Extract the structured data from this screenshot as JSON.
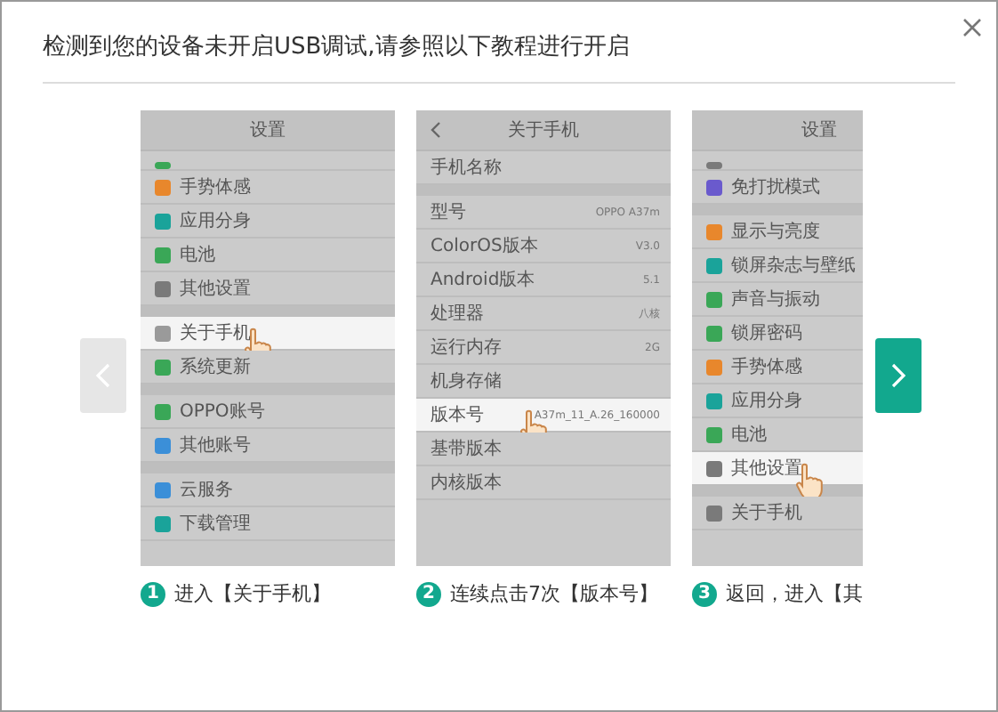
{
  "dialog": {
    "title": "检测到您的设备未开启USB调试,请参照以下教程进行开启"
  },
  "steps": [
    {
      "number": "1",
      "caption": "进入【关于手机】",
      "screen": {
        "title": "设置",
        "back": false,
        "rows": [
          {
            "kind": "partial",
            "color": "#3aa757"
          },
          {
            "kind": "row",
            "label": "手势体感",
            "color": "#e8872c",
            "highlighted": false
          },
          {
            "kind": "row",
            "label": "应用分身",
            "color": "#1aa39a",
            "highlighted": false
          },
          {
            "kind": "row",
            "label": "电池",
            "color": "#3aa757",
            "highlighted": false
          },
          {
            "kind": "row",
            "label": "其他设置",
            "color": "#7a7a7a",
            "highlighted": false
          },
          {
            "kind": "gap"
          },
          {
            "kind": "row",
            "label": "关于手机",
            "color": "#9a9a9a",
            "highlighted": true
          },
          {
            "kind": "row",
            "label": "系统更新",
            "color": "#3aa757",
            "highlighted": false
          },
          {
            "kind": "gap"
          },
          {
            "kind": "row",
            "label": "OPPO账号",
            "color": "#3aa757",
            "highlighted": false
          },
          {
            "kind": "row",
            "label": "其他账号",
            "color": "#3b8fd8",
            "highlighted": false
          },
          {
            "kind": "gap"
          },
          {
            "kind": "row",
            "label": "云服务",
            "color": "#3b8fd8",
            "highlighted": false
          },
          {
            "kind": "row",
            "label": "下载管理",
            "color": "#1aa39a",
            "highlighted": false
          }
        ]
      }
    },
    {
      "number": "2",
      "caption": "连续点击7次【版本号】",
      "screen": {
        "title": "关于手机",
        "back": true,
        "rows": [
          {
            "kind": "info",
            "label": "手机名称",
            "highlighted": false
          },
          {
            "kind": "gap"
          },
          {
            "kind": "info",
            "label": "型号",
            "value": "OPPO A37m",
            "highlighted": false
          },
          {
            "kind": "info",
            "label": "ColorOS版本",
            "value": "V3.0",
            "highlighted": false
          },
          {
            "kind": "info",
            "label": "Android版本",
            "value": "5.1",
            "highlighted": false
          },
          {
            "kind": "info",
            "label": "处理器",
            "value": "八核",
            "highlighted": false
          },
          {
            "kind": "info",
            "label": "运行内存",
            "value": "2G",
            "highlighted": false
          },
          {
            "kind": "info",
            "label": "机身存储",
            "highlighted": false
          },
          {
            "kind": "info",
            "label": "版本号",
            "value": "A37m_11_A.26_160000",
            "highlighted": true
          },
          {
            "kind": "info",
            "label": "基带版本",
            "highlighted": false
          },
          {
            "kind": "info",
            "label": "内核版本",
            "highlighted": false
          }
        ]
      }
    },
    {
      "number": "3",
      "caption": "返回，进入【其",
      "screen": {
        "title": "设置",
        "back": false,
        "rows": [
          {
            "kind": "partial",
            "color": "#7a7a7a"
          },
          {
            "kind": "row",
            "label": "免打扰模式",
            "color": "#6a5acd",
            "highlighted": false
          },
          {
            "kind": "gap"
          },
          {
            "kind": "row",
            "label": "显示与亮度",
            "color": "#e8872c",
            "highlighted": false
          },
          {
            "kind": "row",
            "label": "锁屏杂志与壁纸",
            "color": "#1aa39a",
            "highlighted": false
          },
          {
            "kind": "row",
            "label": "声音与振动",
            "color": "#3aa757",
            "highlighted": false
          },
          {
            "kind": "row",
            "label": "锁屏密码",
            "color": "#3aa757",
            "highlighted": false
          },
          {
            "kind": "row",
            "label": "手势体感",
            "color": "#e8872c",
            "highlighted": false
          },
          {
            "kind": "row",
            "label": "应用分身",
            "color": "#1aa39a",
            "highlighted": false
          },
          {
            "kind": "row",
            "label": "电池",
            "color": "#3aa757",
            "highlighted": false
          },
          {
            "kind": "row",
            "label": "其他设置",
            "color": "#7a7a7a",
            "highlighted": true
          },
          {
            "kind": "gap"
          },
          {
            "kind": "row",
            "label": "关于手机",
            "color": "#7a7a7a",
            "highlighted": false
          }
        ]
      }
    }
  ]
}
